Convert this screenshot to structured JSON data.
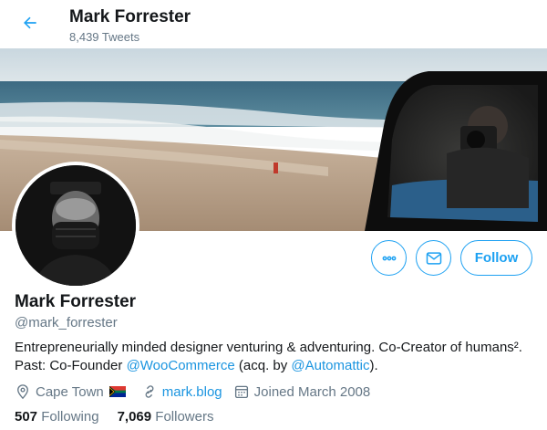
{
  "header": {
    "name": "Mark Forrester",
    "tweet_count": "8,439 Tweets",
    "back_icon": "arrow-left-icon"
  },
  "profile": {
    "display_name": "Mark Forrester",
    "handle": "@mark_forrester",
    "bio": {
      "text_1": "Entrepreneurially minded designer venturing & adventuring. Co-Creator of humans².",
      "text_2": "Past: Co-Founder ",
      "link_1": "@WooCommerce",
      "text_3": " (acq. by ",
      "link_2": "@Automattic",
      "text_4": ")."
    },
    "location": "Cape Town",
    "website": "mark.blog",
    "joined": "Joined March 2008"
  },
  "actions": {
    "more_icon": "more-icon",
    "message_icon": "mail-icon",
    "follow_label": "Follow"
  },
  "stats": {
    "following_count": "507",
    "following_label": "Following",
    "followers_count": "7,069",
    "followers_label": "Followers"
  },
  "colors": {
    "accent": "#1da1f2",
    "secondary_text": "#657786",
    "primary_text": "#14171a"
  }
}
